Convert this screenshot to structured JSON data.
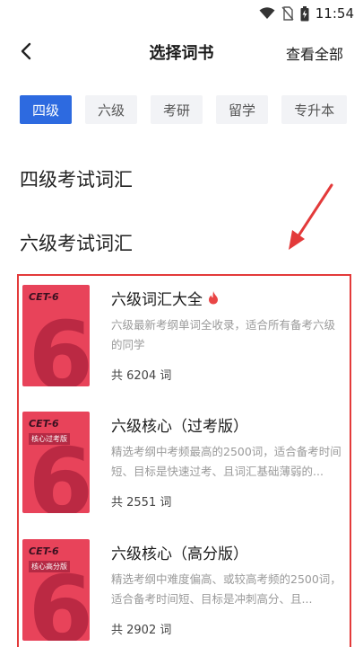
{
  "status_bar": {
    "time": "11:54",
    "icons": [
      "wifi-icon",
      "no-sim-icon",
      "battery-charging-icon"
    ]
  },
  "header": {
    "title": "选择词书",
    "view_all": "查看全部",
    "back_icon": "back-arrow-icon"
  },
  "tabs": [
    {
      "label": "四级",
      "active": true
    },
    {
      "label": "六级",
      "active": false
    },
    {
      "label": "考研",
      "active": false
    },
    {
      "label": "留学",
      "active": false
    },
    {
      "label": "专升本",
      "active": false
    }
  ],
  "sections": {
    "cet4": "四级考试词汇",
    "cet6": "六级考试词汇"
  },
  "colors": {
    "accent": "#2d6ae0",
    "highlight_border": "#e33a3a",
    "cover": "#e8435a",
    "hot": "#e94545"
  },
  "books": [
    {
      "title": "六级词汇大全",
      "hot": true,
      "desc": "六级最新考纲单词全收录，适合所有备考六级的同学",
      "count": "共 6204 词",
      "cover_brand": "CET-6",
      "cover_tag": "",
      "cover_numeral": "6"
    },
    {
      "title": "六级核心（过考版）",
      "hot": false,
      "desc": "精选考纲中考频最高的2500词，适合备考时间短、目标是快速过考、且词汇基础薄弱的...",
      "count": "共 2551 词",
      "cover_brand": "CET-6",
      "cover_tag": "核心过考版",
      "cover_numeral": "6"
    },
    {
      "title": "六级核心（高分版）",
      "hot": false,
      "desc": "精选考纲中难度偏高、或较高考频的2500词，适合备考时间短、目标是冲刺高分、且...",
      "count": "共 2902 词",
      "cover_brand": "CET-6",
      "cover_tag": "核心高分版",
      "cover_numeral": "6"
    }
  ]
}
